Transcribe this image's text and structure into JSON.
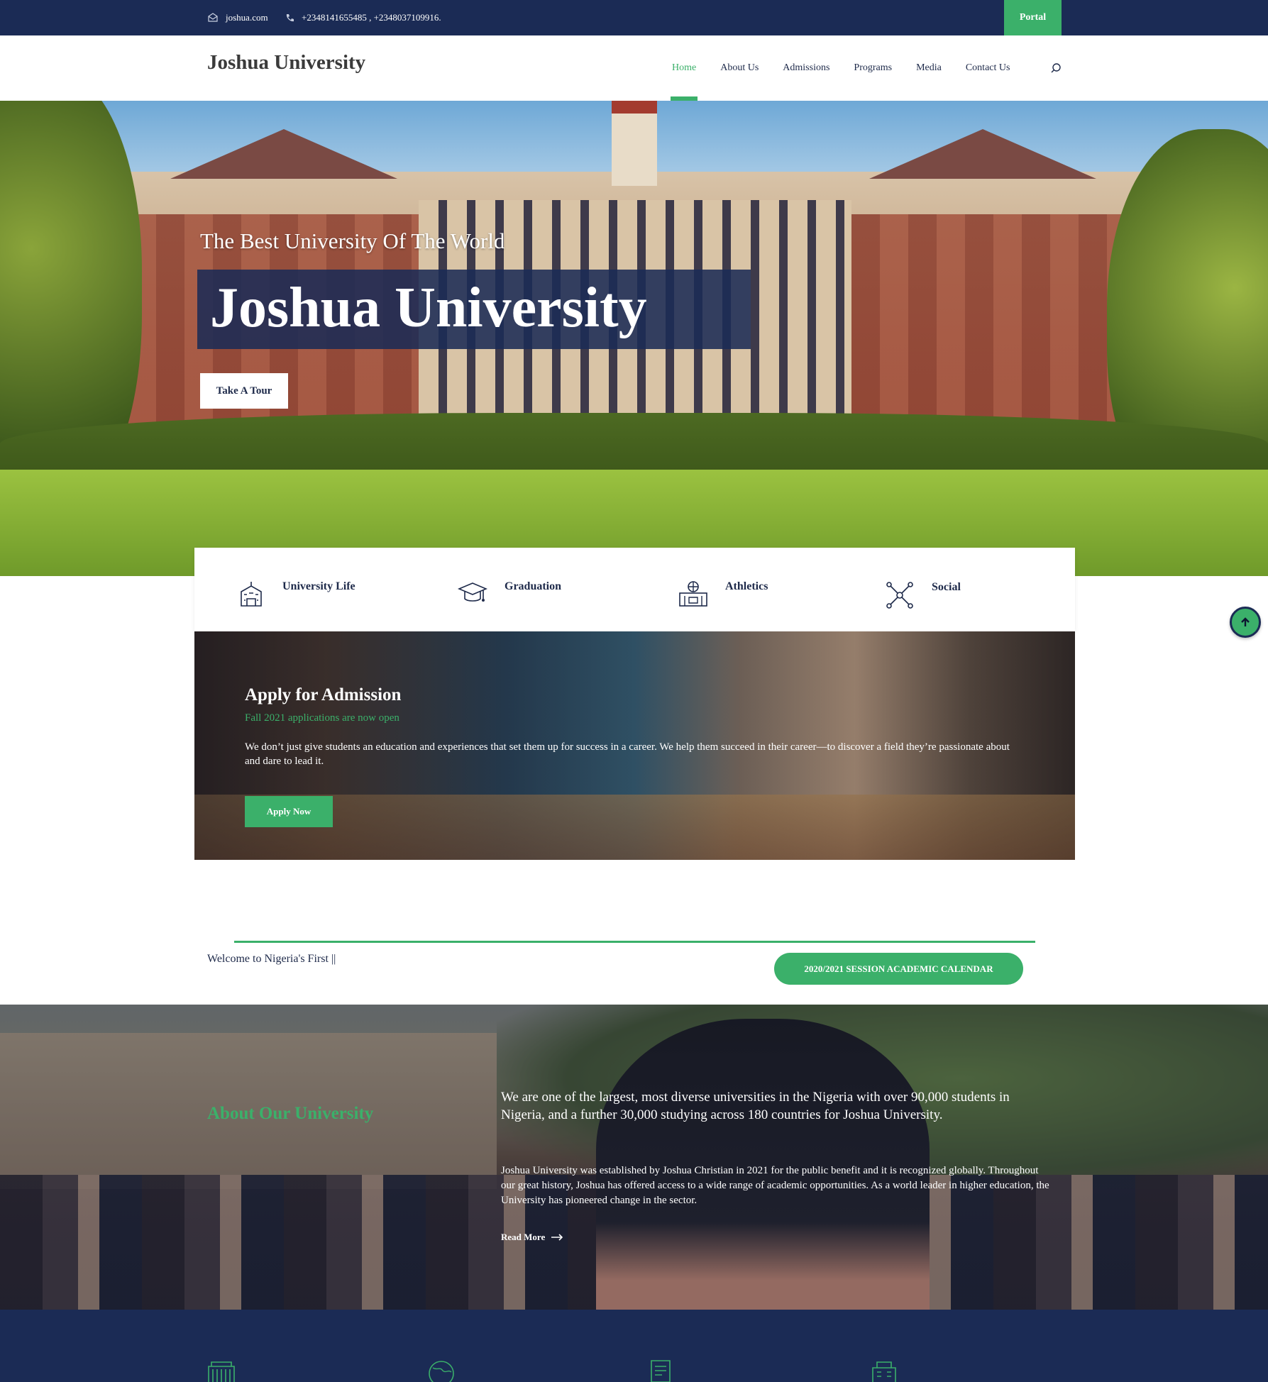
{
  "topbar": {
    "email": "joshua.com",
    "phone": "+2348141655485 , +2348037109916.",
    "portal_label": "Portal"
  },
  "header": {
    "logo": "Joshua University",
    "nav": [
      {
        "label": "Home",
        "active": true
      },
      {
        "label": "About Us"
      },
      {
        "label": "Admissions"
      },
      {
        "label": "Programs"
      },
      {
        "label": "Media"
      },
      {
        "label": "Contact Us"
      }
    ],
    "search_icon": "search-icon"
  },
  "hero": {
    "subtitle": "The Best University Of The World",
    "title": "Joshua University",
    "cta": "Take A Tour"
  },
  "features": [
    {
      "label": "University Life",
      "icon": "building-icon"
    },
    {
      "label": "Graduation",
      "icon": "graduation-cap-icon"
    },
    {
      "label": "Athletics",
      "icon": "basketball-court-icon"
    },
    {
      "label": "Social",
      "icon": "network-icon"
    }
  ],
  "admission": {
    "title": "Apply for Admission",
    "subtitle": "Fall 2021 applications are now open",
    "text": "We don’t just give students an education and experiences that set them up for success in a career. We help them succeed in their career—to discover a field they’re passionate about and dare to lead it.",
    "button": "Apply Now"
  },
  "welcome": {
    "text": "Welcome to Nigeria's First ||",
    "calendar_button": "2020/2021 SESSION ACADEMIC CALENDAR"
  },
  "about": {
    "title": "About Our University",
    "lead": "We are one of the largest, most diverse universities in the Nigeria with over 90,000 students in Nigeria, and a further 30,000 studying across 180 countries for Joshua University.",
    "body": "Joshua University was established by Joshua Christian in 2021 for the public benefit and it is recognized globally. Throughout our great history, Joshua has offered access to a wide range of academic opportunities. As a world leader in higher education, the University has pioneered change in the sector.",
    "read_more": "Read More"
  },
  "colors": {
    "navy": "#1b2b55",
    "green": "#3bb06a"
  }
}
